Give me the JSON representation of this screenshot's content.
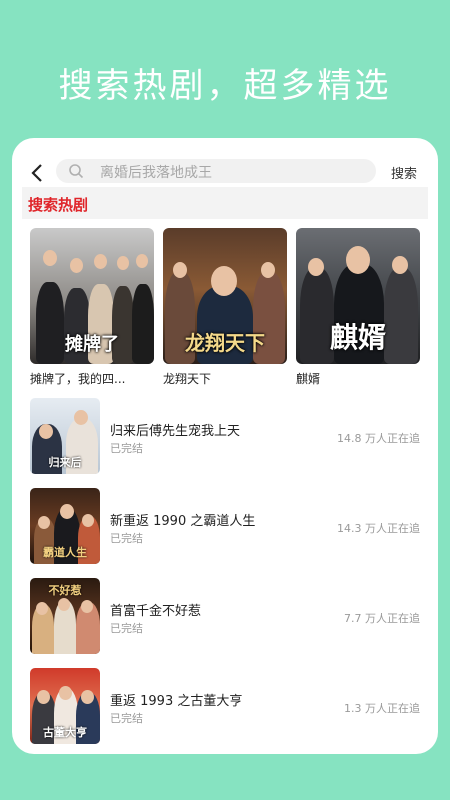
{
  "headline": "搜索热剧，超多精选",
  "search": {
    "back_icon": "chevron-left-icon",
    "placeholder": "离婚后我落地成王",
    "button_label": "搜索"
  },
  "section_title": "搜索热剧",
  "top_dramas": [
    {
      "caption": "摊牌了，我的四...",
      "poster_text": "摊牌了"
    },
    {
      "caption": "龙翔天下",
      "poster_text": "龙翔天下"
    },
    {
      "caption": "麒婿",
      "poster_text": "麒婿"
    }
  ],
  "list": [
    {
      "title": "归来后傅先生宠我上天",
      "status": "已完结",
      "count": "14.8 万人正在追",
      "thumb_text": "归来后"
    },
    {
      "title": "新重返 1990 之霸道人生",
      "status": "已完结",
      "count": "14.3 万人正在追",
      "thumb_text": "霸道人生"
    },
    {
      "title": "首富千金不好惹",
      "status": "已完结",
      "count": "7.7 万人正在追",
      "thumb_text": "不好惹"
    },
    {
      "title": "重返 1993 之古董大亨",
      "status": "已完结",
      "count": "1.3 万人正在追",
      "thumb_text": "古董大亨"
    }
  ],
  "colors": {
    "background": "#86e3c1",
    "accent_red": "#e0252a"
  }
}
